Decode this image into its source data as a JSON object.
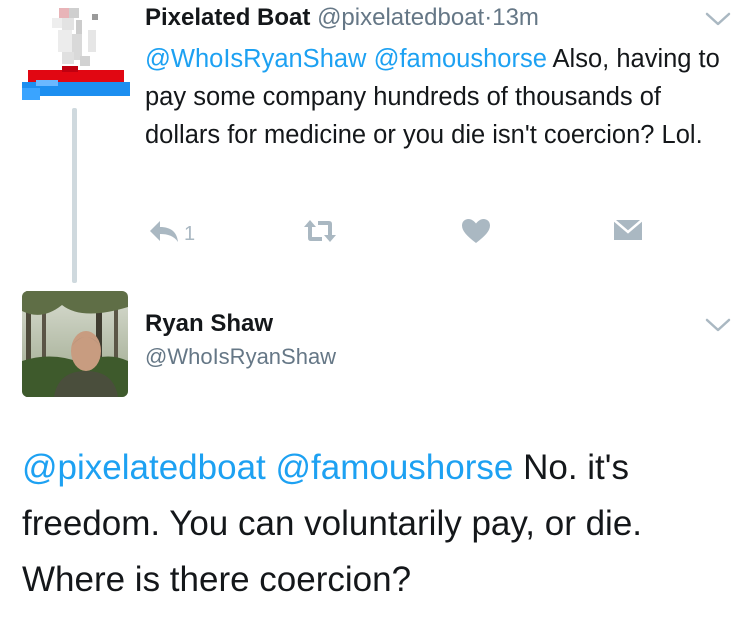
{
  "tweet1": {
    "name": "Pixelated Boat",
    "handle": "@pixelatedboat",
    "separator": "·",
    "time": "13m",
    "mention1": "@WhoIsRyanShaw",
    "mention2": "@famoushorse",
    "text": " Also, having to pay some company hundreds of thousands of dollars for medicine or you die isn't coercion? Lol.",
    "reply_count": "1"
  },
  "tweet2": {
    "name": "Ryan Shaw",
    "handle": "@WhoIsRyanShaw",
    "mention1": "@pixelatedboat",
    "mention2": "@famoushorse",
    "text": " No. it's freedom. You can voluntarily pay, or die. Where is there coercion?"
  },
  "colors": {
    "link": "#1da1f2",
    "secondary_text": "#657786",
    "action_icon": "#aab8c2",
    "thread_line": "#cfd9de"
  },
  "icons": [
    "pixel-boat-avatar",
    "chevron-down-icon",
    "reply-icon",
    "retweet-icon",
    "heart-icon",
    "direct-message-icon",
    "photo-avatar"
  ]
}
